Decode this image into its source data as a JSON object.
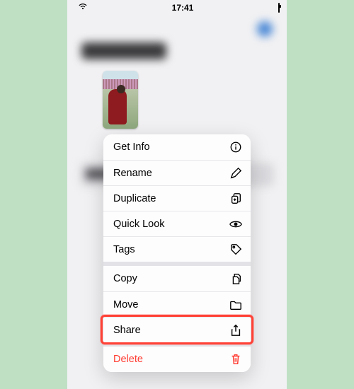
{
  "status": {
    "time": "17:41"
  },
  "background": {
    "title": "Recents"
  },
  "menu": {
    "sections": [
      {
        "items": [
          {
            "key": "get-info",
            "label": "Get Info"
          },
          {
            "key": "rename",
            "label": "Rename"
          },
          {
            "key": "duplicate",
            "label": "Duplicate"
          },
          {
            "key": "quick-look",
            "label": "Quick Look"
          },
          {
            "key": "tags",
            "label": "Tags"
          }
        ]
      },
      {
        "items": [
          {
            "key": "copy",
            "label": "Copy"
          },
          {
            "key": "move",
            "label": "Move"
          },
          {
            "key": "share",
            "label": "Share"
          }
        ]
      },
      {
        "items": [
          {
            "key": "delete",
            "label": "Delete",
            "destructive": true
          }
        ]
      }
    ]
  },
  "highlight_item_key": "share"
}
